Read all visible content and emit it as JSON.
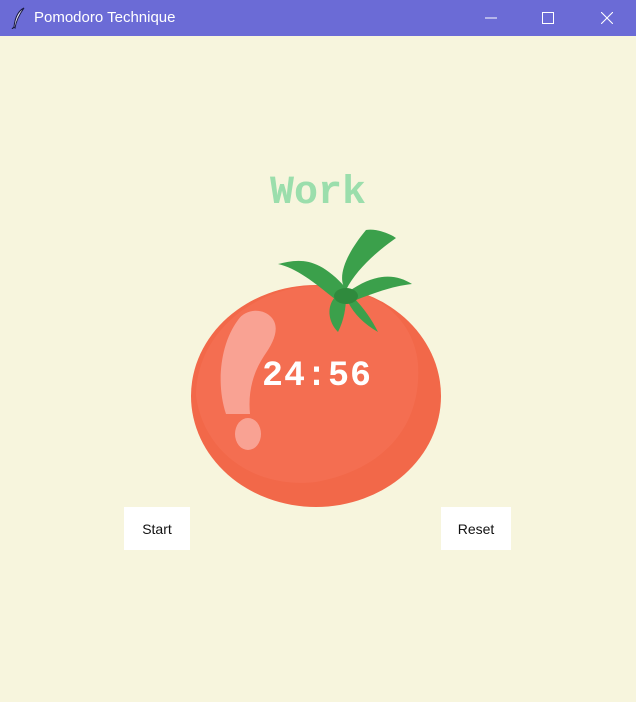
{
  "window": {
    "title": "Pomodoro Technique",
    "icon": "feather-icon",
    "controls": [
      "minimize-icon",
      "maximize-icon",
      "close-icon"
    ]
  },
  "app": {
    "heading": "Work",
    "timer": "24:56",
    "start_label": "Start",
    "reset_label": "Reset"
  },
  "colors": {
    "background": "#f7f5dd",
    "titlebar": "#6b6bd6",
    "heading": "#9bdeac",
    "tomato": "#f26849",
    "leaf": "#379b46"
  }
}
